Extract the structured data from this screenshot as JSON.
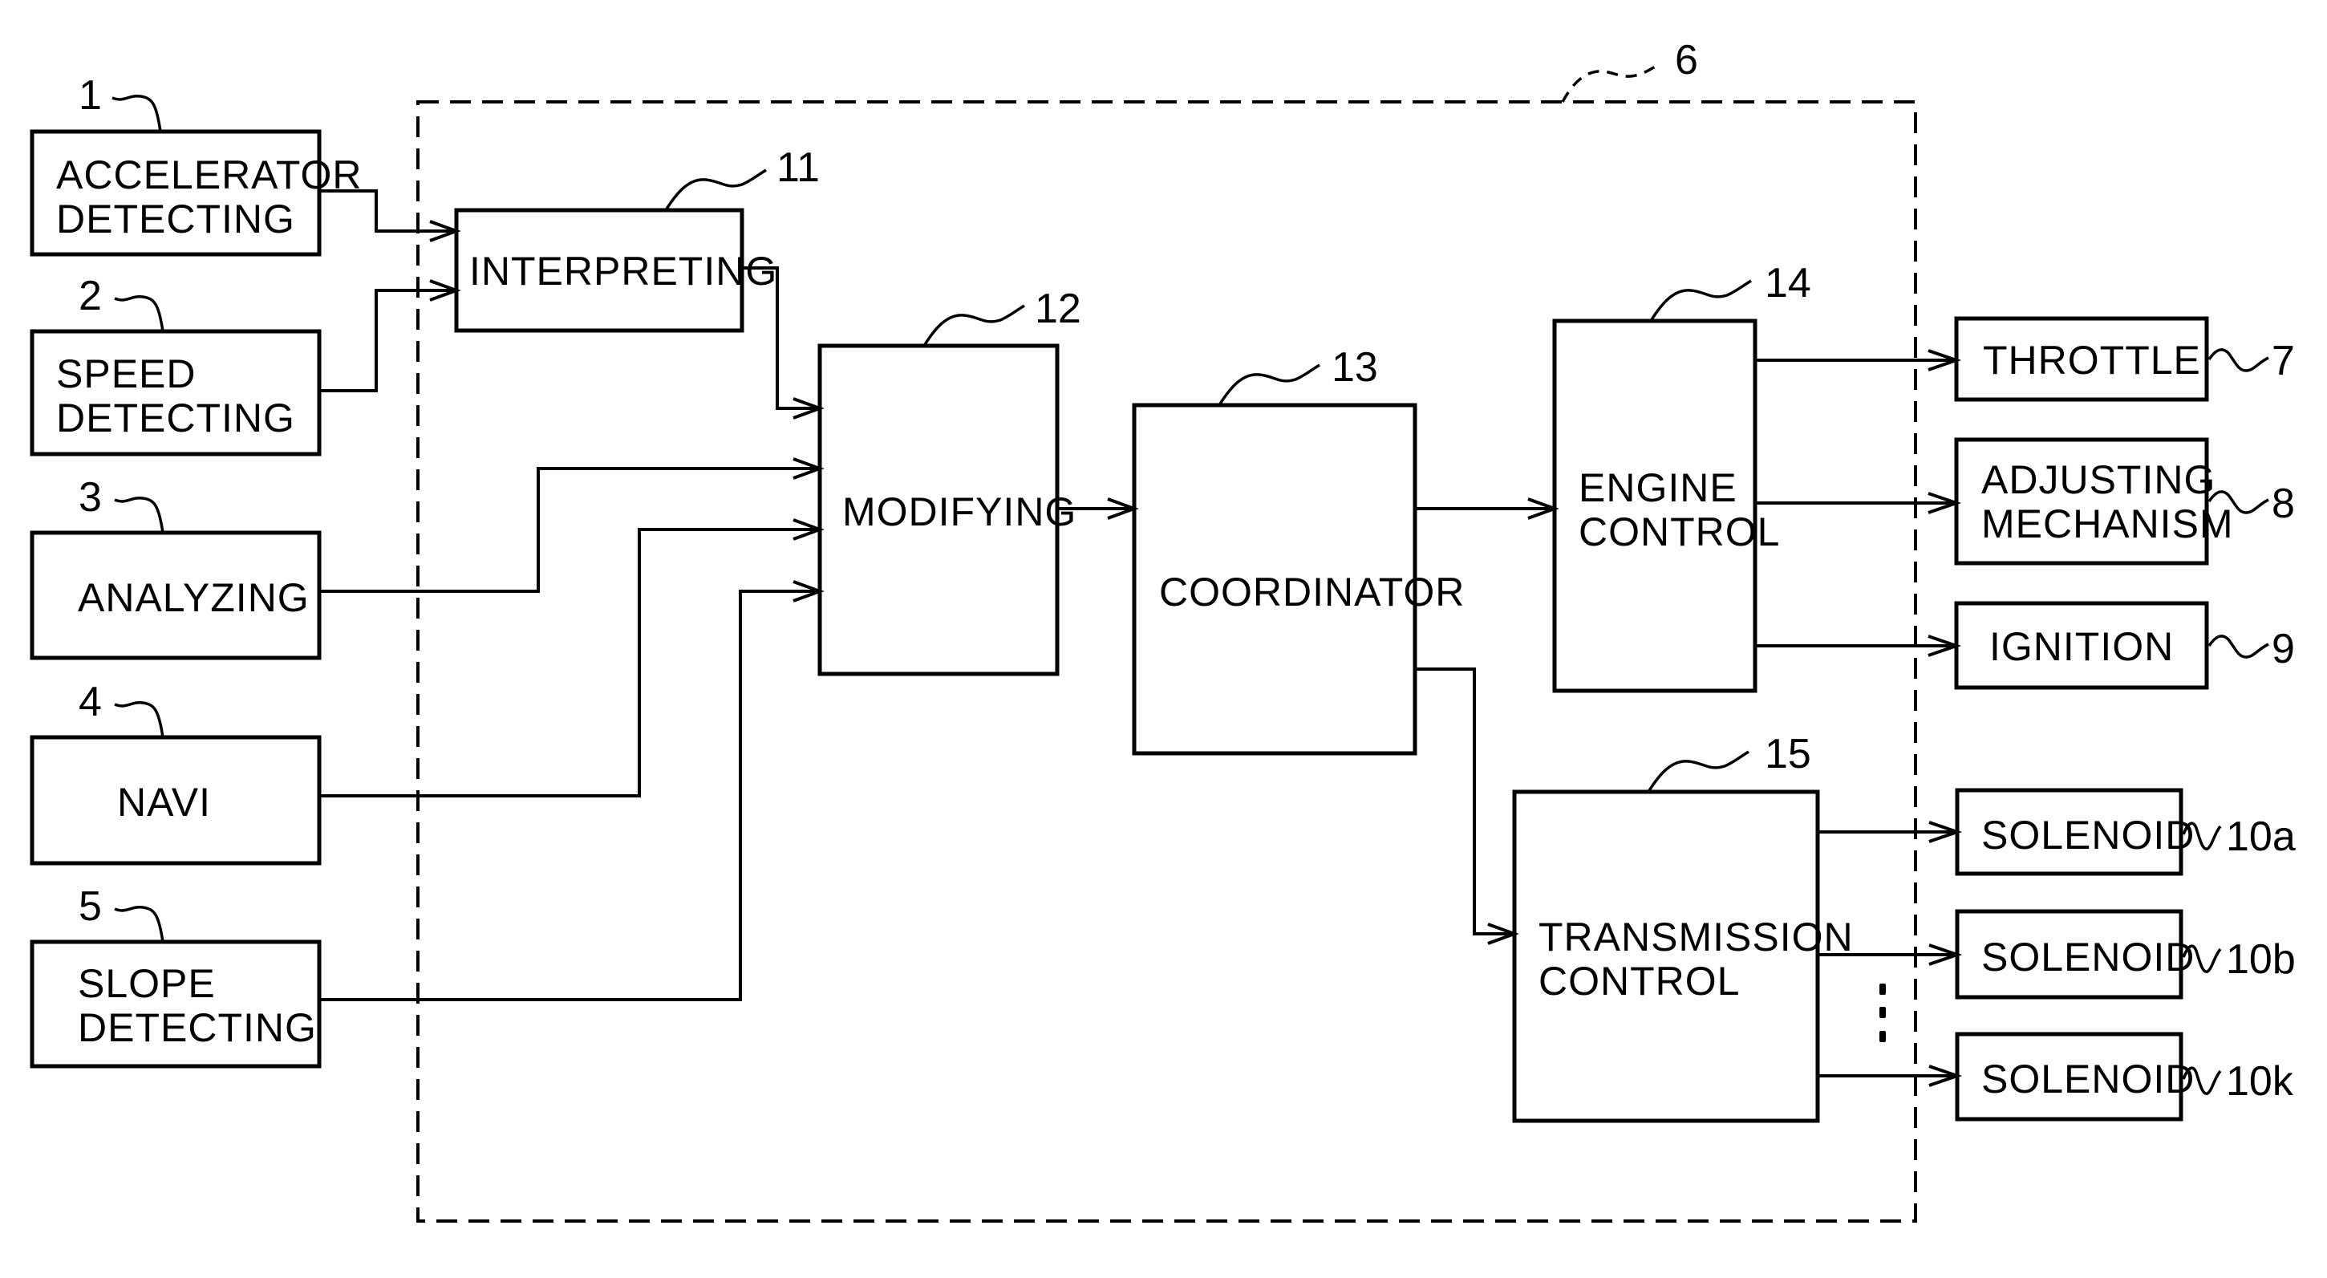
{
  "figure": {
    "system_ref": "6",
    "inputs": [
      {
        "ref": "1",
        "lines": [
          "ACCELERATOR",
          "DETECTING"
        ]
      },
      {
        "ref": "2",
        "lines": [
          "SPEED",
          "DETECTING"
        ]
      },
      {
        "ref": "3",
        "lines": [
          "ANALYZING"
        ]
      },
      {
        "ref": "4",
        "lines": [
          "NAVI"
        ]
      },
      {
        "ref": "5",
        "lines": [
          "SLOPE",
          "DETECTING"
        ]
      }
    ],
    "internal": [
      {
        "ref": "11",
        "lines": [
          "INTERPRETING"
        ]
      },
      {
        "ref": "12",
        "lines": [
          "MODIFYING"
        ]
      },
      {
        "ref": "13",
        "lines": [
          "COORDINATOR"
        ]
      },
      {
        "ref": "14",
        "lines": [
          "ENGINE",
          "CONTROL"
        ]
      },
      {
        "ref": "15",
        "lines": [
          "TRANSMISSION",
          "CONTROL"
        ]
      }
    ],
    "outputs": [
      {
        "ref": "7",
        "lines": [
          "THROTTLE"
        ]
      },
      {
        "ref": "8",
        "lines": [
          "ADJUSTING",
          "MECHANISM"
        ]
      },
      {
        "ref": "9",
        "lines": [
          "IGNITION"
        ]
      },
      {
        "ref": "10a",
        "lines": [
          "SOLENOID"
        ]
      },
      {
        "ref": "10b",
        "lines": [
          "SOLENOID"
        ]
      },
      {
        "ref": "10k",
        "lines": [
          "SOLENOID"
        ]
      }
    ],
    "ellipsis": "⋮"
  }
}
